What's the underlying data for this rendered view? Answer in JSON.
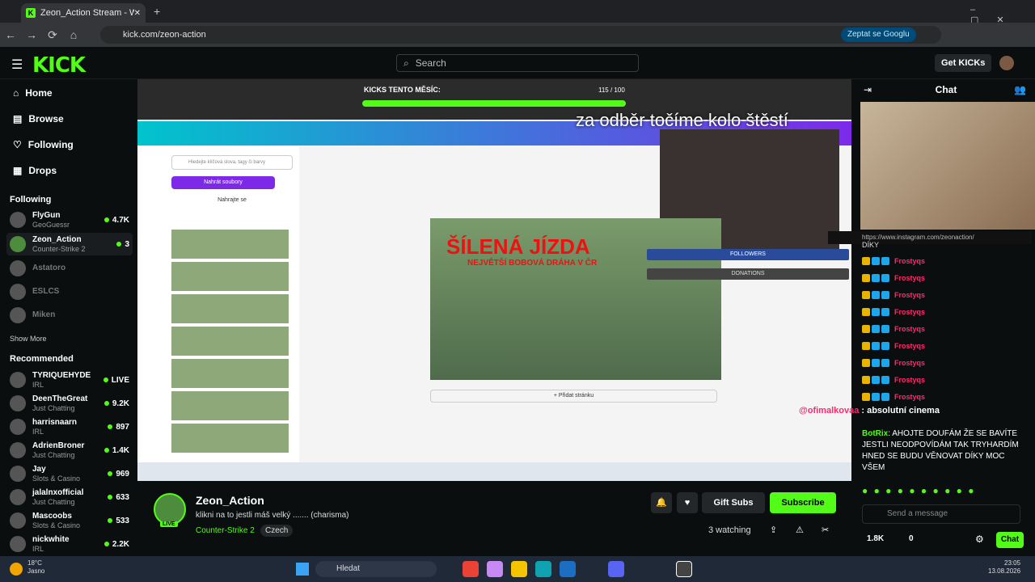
{
  "browser": {
    "tab_title": "Zeon_Action Stream - Watch Li...",
    "url": "kick.com/zeon-action",
    "ask_google": "Zeptat se Googlu"
  },
  "header": {
    "logo": "KICK",
    "search_placeholder": "Search",
    "get_kicks": "Get KICKs"
  },
  "sidebar": {
    "nav": [
      "Home",
      "Browse",
      "Following",
      "Drops"
    ],
    "following_title": "Following",
    "following": [
      {
        "name": "FlyGun",
        "category": "GeoGuessr",
        "count": "4.7K",
        "live": true
      },
      {
        "name": "Zeon_Action",
        "category": "Counter-Strike 2",
        "count": "3",
        "live": true
      },
      {
        "name": "Astatoro",
        "category": "",
        "count": "",
        "live": false
      },
      {
        "name": "ESLCS",
        "category": "",
        "count": "",
        "live": false
      },
      {
        "name": "Miken",
        "category": "",
        "count": "",
        "live": false
      }
    ],
    "show_more": "Show More",
    "recommended_title": "Recommended",
    "recommended": [
      {
        "name": "TYRIQUEHYDE",
        "category": "IRL",
        "count": "LIVE"
      },
      {
        "name": "DeenTheGreat",
        "category": "Just Chatting",
        "count": "9.2K"
      },
      {
        "name": "harrisnaarn",
        "category": "IRL",
        "count": "897"
      },
      {
        "name": "AdrienBroner",
        "category": "Just Chatting",
        "count": "1.4K"
      },
      {
        "name": "Jay",
        "category": "Slots & Casino",
        "count": "969"
      },
      {
        "name": "jalalnxofficial",
        "category": "Just Chatting",
        "count": "633"
      },
      {
        "name": "Mascoobs",
        "category": "Slots & Casino",
        "count": "533"
      },
      {
        "name": "nickwhite",
        "category": "IRL",
        "count": "2.2K"
      }
    ]
  },
  "player": {
    "overlay_text": "za odběr točíme kolo štěstí",
    "kicks_month": "KICKS TENTO MĚSÍC:",
    "kicks_val": "115 / 100",
    "thumb_title": "ŠÍLENÁ JÍZDA",
    "thumb_sub": "NEJVĚTŠÍ BOBOVÁ DRÁHA V ČR",
    "followers": "FOLLOWERS",
    "donations": "DONATIONS",
    "add_page": "+ Přidat stránku",
    "search_canva": "Hledejte klíčová slova, tagy či barvy",
    "upload": "Nahrát soubory",
    "record": "Nahrajte se"
  },
  "stream": {
    "name": "Zeon_Action",
    "title": "klikni na to jestli máš velký ....... (charisma)",
    "category": "Counter-Strike 2",
    "language": "Czech",
    "live": "LIVE",
    "watching": "3 watching",
    "gift_subs": "Gift Subs",
    "subscribe": "Subscribe"
  },
  "chat": {
    "title": "Chat",
    "instagram": "https://www.instagram.com/zeonaction/",
    "diky": "DÍKY",
    "user": "Frostyqs",
    "overlay_msg_user": "@ofimalkovaa",
    "overlay_msg": "absolutní cinema",
    "bot_user": "BotRix",
    "bot_msg": "AHOJTE DOUFÁM ŽE SE BAVÍTE JESTLI NEODPOVÍDÁM TAK TRYHARDÍM HNED SE BUDU VĚNOVAT DÍKY MOC VŠEM",
    "send_placeholder": "Send a message",
    "count1": "1.8K",
    "count2": "0",
    "chat_btn": "Chat"
  },
  "taskbar": {
    "weather_temp": "18°C",
    "weather_desc": "Jasno",
    "search": "Hledat",
    "time": "23:05",
    "date": "13.08.2026"
  },
  "colors": {
    "accent": "#53fc18",
    "bg": "#0b0e0f"
  }
}
